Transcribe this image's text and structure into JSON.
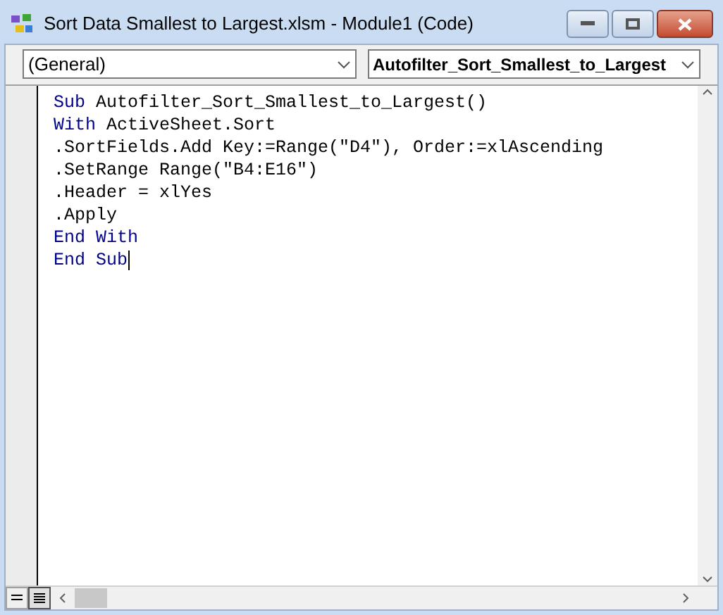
{
  "window": {
    "title": "Sort Data Smallest to Largest.xlsm - Module1 (Code)"
  },
  "object_dropdown": {
    "value": "(General)"
  },
  "procedure_dropdown": {
    "value": "Autofilter_Sort_Smallest_to_Largest"
  },
  "code_lines": [
    {
      "tokens": [
        {
          "text": "Sub",
          "keyword": true
        },
        {
          "text": " Autofilter_Sort_Smallest_to_Largest()",
          "keyword": false
        }
      ]
    },
    {
      "tokens": [
        {
          "text": "With",
          "keyword": true
        },
        {
          "text": " ActiveSheet.Sort",
          "keyword": false
        }
      ]
    },
    {
      "tokens": [
        {
          "text": ".SortFields.Add Key:=Range(\"D4\"), Order:=xlAscending",
          "keyword": false
        }
      ]
    },
    {
      "tokens": [
        {
          "text": ".SetRange Range(\"B4:E16\")",
          "keyword": false
        }
      ]
    },
    {
      "tokens": [
        {
          "text": ".Header = xlYes",
          "keyword": false
        }
      ]
    },
    {
      "tokens": [
        {
          "text": ".Apply",
          "keyword": false
        }
      ]
    },
    {
      "tokens": [
        {
          "text": "End With",
          "keyword": true
        }
      ]
    },
    {
      "tokens": [
        {
          "text": "End Sub",
          "keyword": true
        }
      ],
      "cursor": true
    }
  ],
  "view_buttons": [
    {
      "kind": "procedure",
      "selected": false
    },
    {
      "kind": "module",
      "selected": true
    }
  ]
}
